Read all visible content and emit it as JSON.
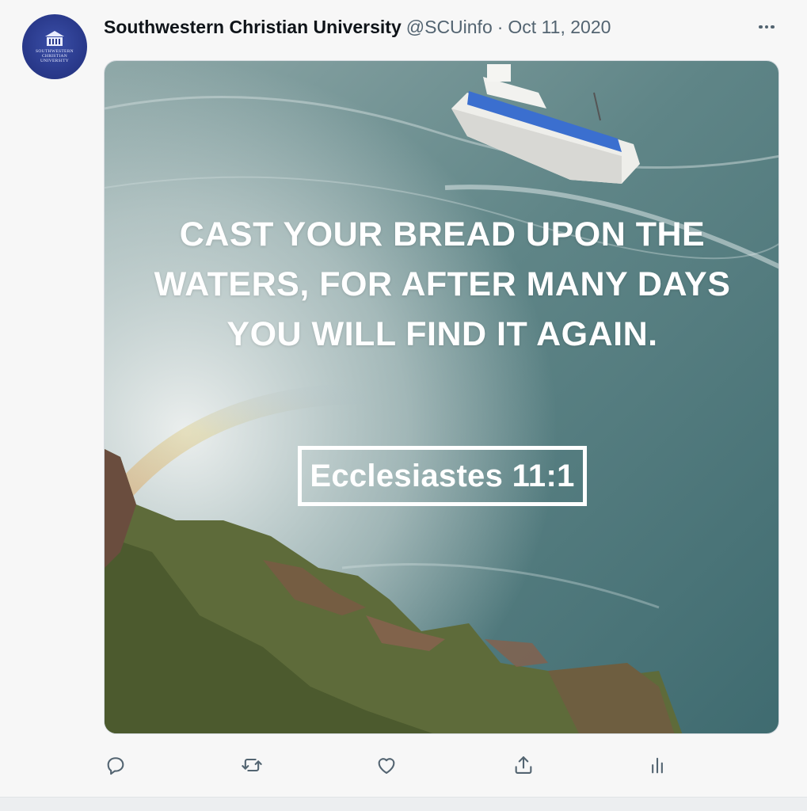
{
  "tweet": {
    "author": {
      "display_name": "Southwestern Christian University",
      "handle": "@SCUinfo",
      "avatar_text": "SOUTHWESTERN CHRISTIAN UNIVERSITY"
    },
    "separator": "·",
    "date": "Oct 11, 2020",
    "media": {
      "quote": "CAST YOUR BREAD UPON THE WATERS, FOR AFTER MANY DAYS YOU WILL FIND IT AGAIN.",
      "reference": "Ecclesiastes 11:1"
    },
    "actions": [
      {
        "name": "reply",
        "icon": "reply-icon"
      },
      {
        "name": "retweet",
        "icon": "retweet-icon"
      },
      {
        "name": "like",
        "icon": "heart-icon"
      },
      {
        "name": "share",
        "icon": "share-icon"
      },
      {
        "name": "analytics",
        "icon": "analytics-icon"
      }
    ]
  },
  "colors": {
    "icon": "#536471",
    "text": "#0f1419",
    "water": "#4f7a7c",
    "avatar": "#2a3a8c"
  }
}
